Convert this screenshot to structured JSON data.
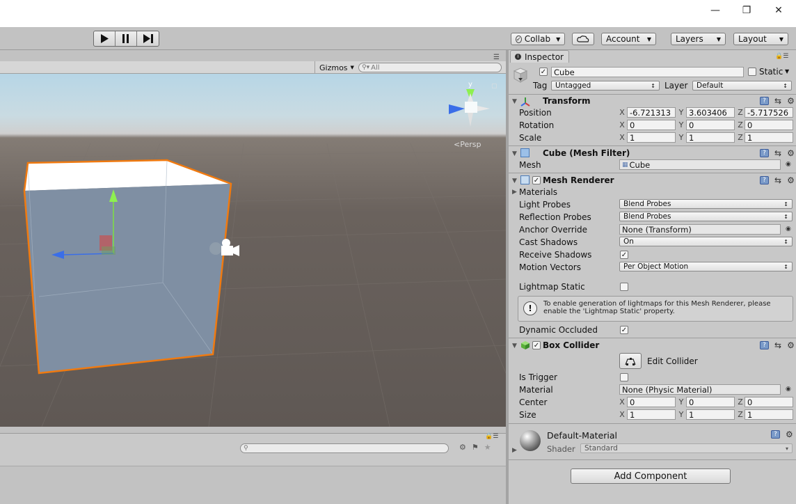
{
  "toolbar": {
    "collab": "Collab",
    "account": "Account",
    "layers": "Layers",
    "layout": "Layout"
  },
  "scene": {
    "gizmos": "Gizmos",
    "search_placeholder": "All",
    "persp_label": "Persp"
  },
  "inspector": {
    "tab": "Inspector",
    "object": {
      "name": "Cube",
      "active": true,
      "static_label": "Static",
      "tag_label": "Tag",
      "tag_value": "Untagged",
      "layer_label": "Layer",
      "layer_value": "Default"
    },
    "transform": {
      "title": "Transform",
      "position_label": "Position",
      "rotation_label": "Rotation",
      "scale_label": "Scale",
      "position": {
        "x": "-6.721313",
        "y": "3.603406",
        "z": "-5.717526"
      },
      "rotation": {
        "x": "0",
        "y": "0",
        "z": "0"
      },
      "scale": {
        "x": "1",
        "y": "1",
        "z": "1"
      }
    },
    "mesh_filter": {
      "title": "Cube (Mesh Filter)",
      "mesh_label": "Mesh",
      "mesh_value": "Cube"
    },
    "mesh_renderer": {
      "title": "Mesh Renderer",
      "materials_label": "Materials",
      "light_probes_label": "Light Probes",
      "light_probes_value": "Blend Probes",
      "reflection_probes_label": "Reflection Probes",
      "reflection_probes_value": "Blend Probes",
      "anchor_override_label": "Anchor Override",
      "anchor_override_value": "None (Transform)",
      "cast_shadows_label": "Cast Shadows",
      "cast_shadows_value": "On",
      "receive_shadows_label": "Receive Shadows",
      "motion_vectors_label": "Motion Vectors",
      "motion_vectors_value": "Per Object Motion",
      "lightmap_static_label": "Lightmap Static",
      "info_line1": "To enable generation of lightmaps for this Mesh Renderer, please",
      "info_line2": "enable the 'Lightmap Static' property.",
      "dynamic_occluded_label": "Dynamic Occluded"
    },
    "box_collider": {
      "title": "Box Collider",
      "edit_collider": "Edit Collider",
      "is_trigger_label": "Is Trigger",
      "material_label": "Material",
      "material_value": "None (Physic Material)",
      "center_label": "Center",
      "size_label": "Size",
      "center": {
        "x": "0",
        "y": "0",
        "z": "0"
      },
      "size": {
        "x": "1",
        "y": "1",
        "z": "1"
      }
    },
    "material": {
      "name": "Default-Material",
      "shader_label": "Shader",
      "shader_value": "Standard"
    },
    "add_component": "Add Component"
  },
  "axes": {
    "x": "X",
    "y": "Y",
    "z": "Z"
  },
  "colors": {
    "selection_outline": "#f07a10",
    "cube_face": "#7d8ea3",
    "cube_top": "#ffffff"
  }
}
